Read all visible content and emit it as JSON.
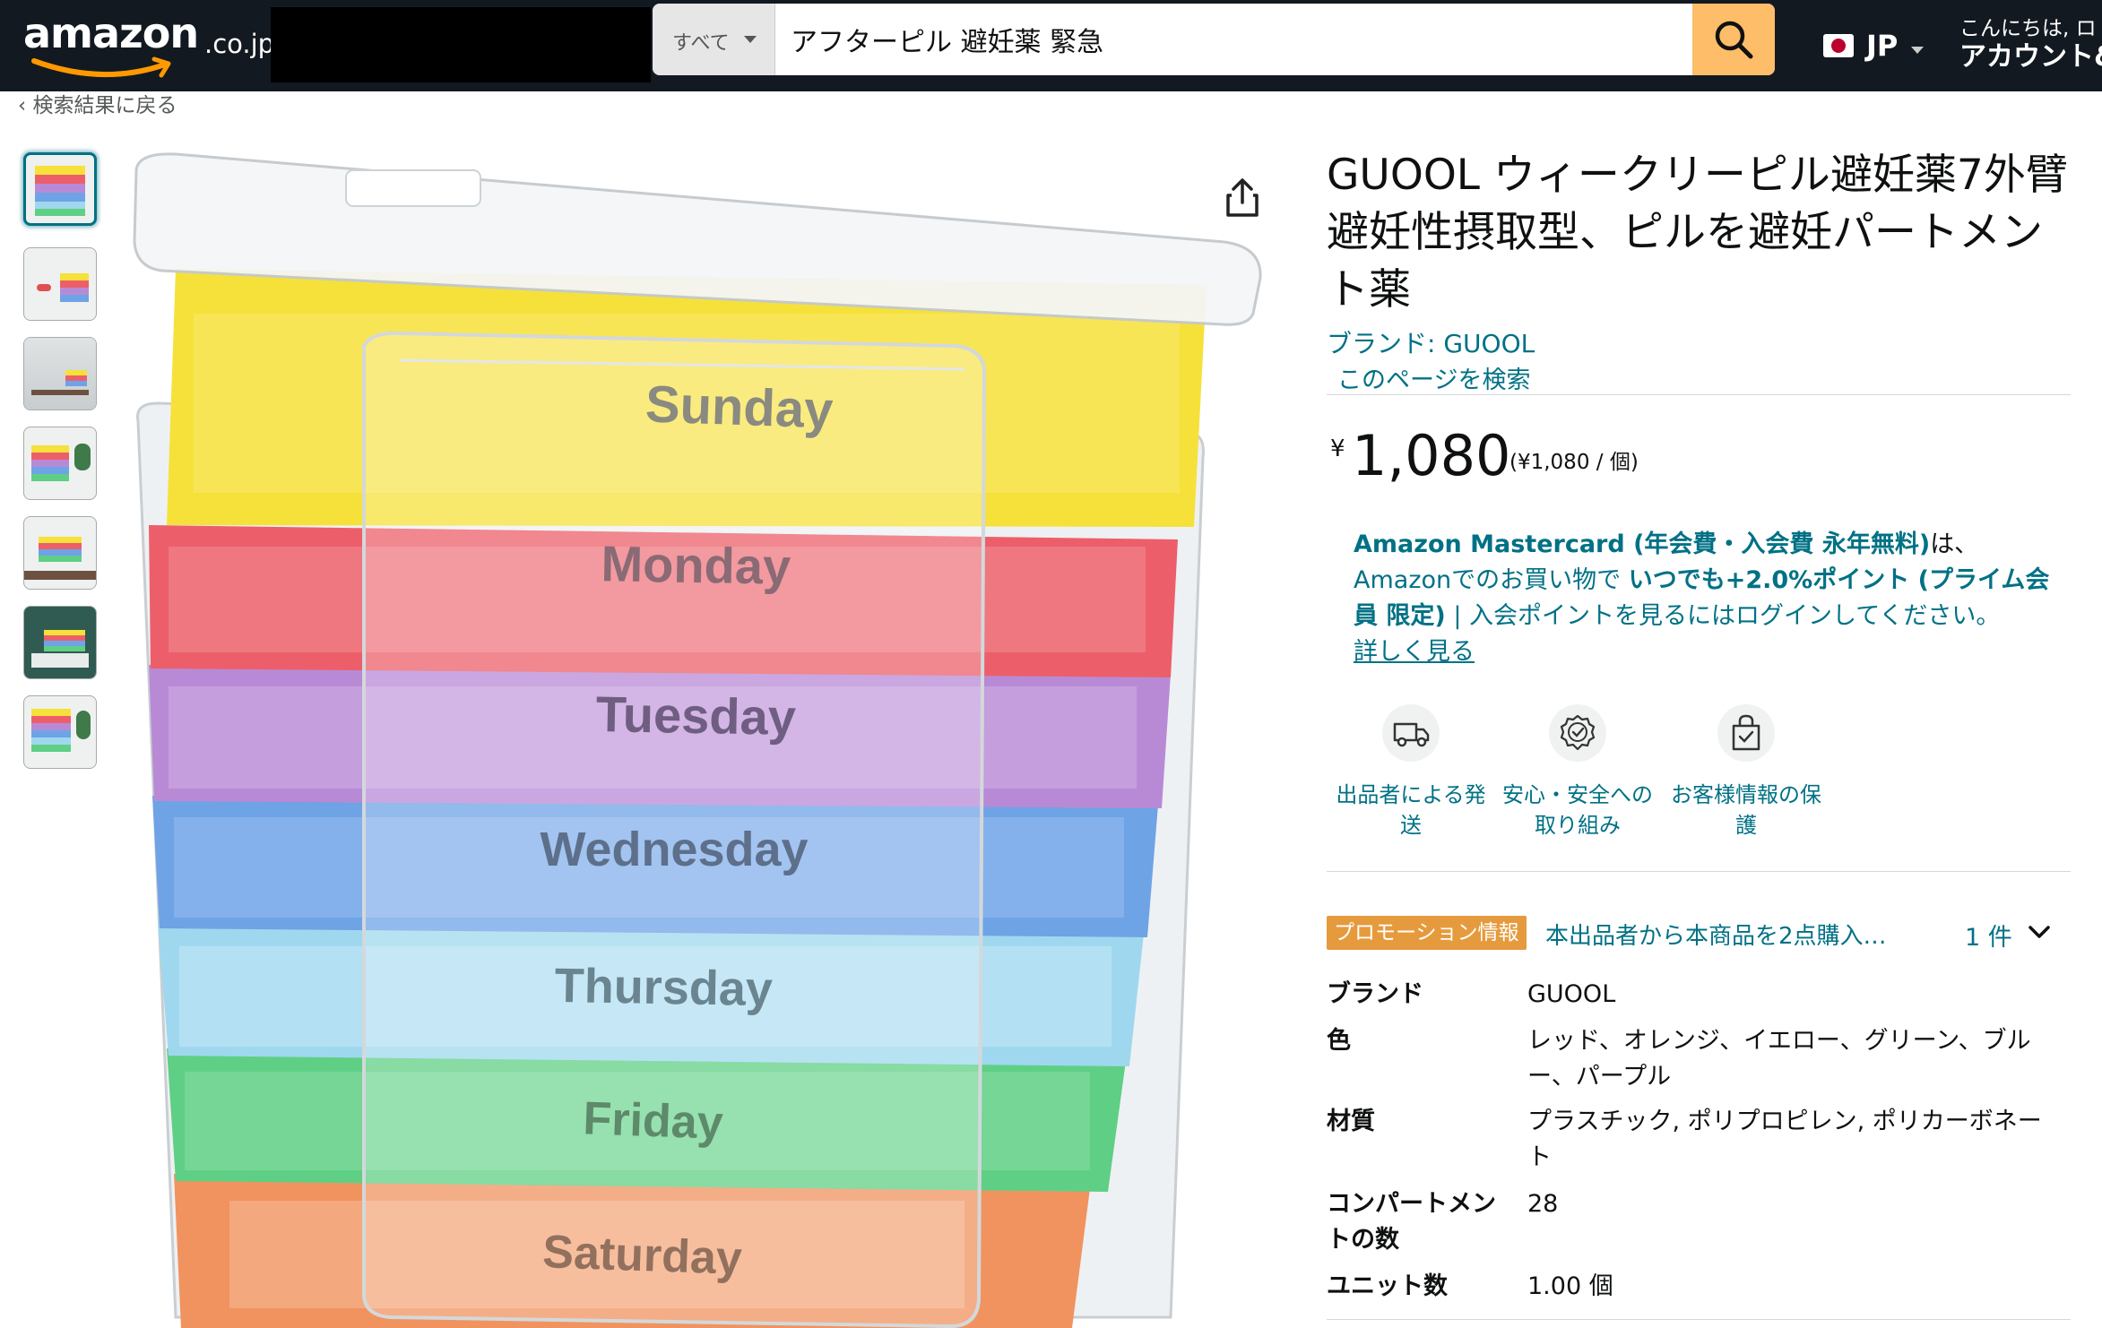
{
  "nav": {
    "logo_word": "amazon",
    "logo_tld": ".co.jp",
    "search_category": "すべて",
    "search_query": "アフターピル 避妊薬 緊急",
    "lang": "JP",
    "greeting": "こんにちは, ロ",
    "account": "アカウント&"
  },
  "breadcrumb": {
    "back": "‹ 検索結果に戻る"
  },
  "gallery": {
    "day_labels": [
      "Sunday",
      "Monday",
      "Tuesday",
      "Wednesday",
      "Thursday",
      "Friday",
      "Saturday"
    ],
    "colors": {
      "yellow": "#f6e13a",
      "red": "#ec5f6a",
      "purple": "#b88ad6",
      "blue": "#6ea3e6",
      "light_blue": "#9fd8ee",
      "green": "#5fcf85",
      "orange": "#f1935f"
    },
    "share_icon": "share-icon"
  },
  "product": {
    "title": "GUOOL ウィークリーピル避妊薬7外臂避妊性摂取型、ピルを避妊パートメント薬",
    "brand_link": "ブランド: GUOOL",
    "search_page": "このページを検索",
    "price_symbol": "¥",
    "price_whole": "1,080",
    "price_per_unit": "(¥1,080 / 個)"
  },
  "card_promo": {
    "card_name": "Amazon Mastercard (年会費・入会費 永年無料)",
    "text1": "は、",
    "text2": "Amazonでのお買い物で",
    "points": "いつでも+2.0%ポイント (プライム会員 限定)",
    "text3": " | 入会ポイントを見るにはログインしてください。",
    "more": "詳しく見る"
  },
  "features": [
    {
      "icon": "delivery-truck-icon",
      "label": "出品者による発送"
    },
    {
      "icon": "security-badge-icon",
      "label": "安心・安全への取り組み"
    },
    {
      "icon": "secure-bag-icon",
      "label": "お客様情報の保護"
    }
  ],
  "promotion": {
    "badge": "プロモーション情報",
    "desc": "本出品者から本商品を2点購入…",
    "count": "1 件"
  },
  "specs": [
    {
      "key": "ブランド",
      "value": "GUOOL"
    },
    {
      "key": "色",
      "value": "レッド、オレンジ、イエロー、グリーン、ブルー、パープル"
    },
    {
      "key": "材質",
      "value": "プラスチック, ポリプロピレン, ポリカーボネート"
    },
    {
      "key": "コンパートメントの数",
      "value": "28"
    },
    {
      "key": "ユニット数",
      "value": "1.00 個"
    }
  ]
}
